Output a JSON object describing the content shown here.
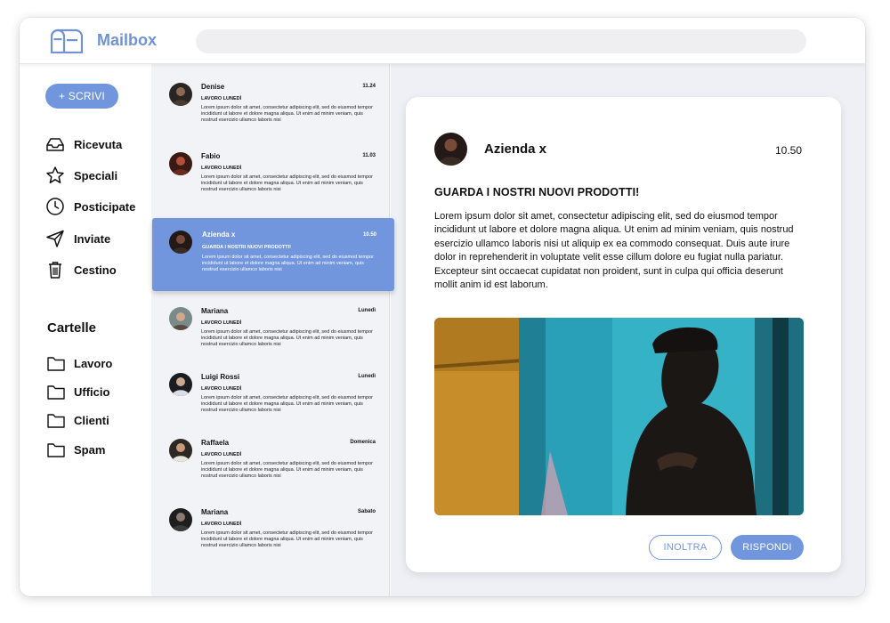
{
  "app": {
    "title": "Mailbox",
    "accent_color": "#7196de"
  },
  "search": {
    "value": "",
    "placeholder": ""
  },
  "sidebar": {
    "compose_label": "+ SCRIVI",
    "nav": [
      {
        "label": "Ricevuta",
        "icon": "inbox-icon"
      },
      {
        "label": "Speciali",
        "icon": "star-icon"
      },
      {
        "label": "Posticipate",
        "icon": "clock-icon"
      },
      {
        "label": "Inviate",
        "icon": "send-icon"
      },
      {
        "label": "Cestino",
        "icon": "trash-icon"
      }
    ],
    "folders_title": "Cartelle",
    "folders": [
      {
        "label": "Lavoro",
        "icon": "folder-icon"
      },
      {
        "label": "Ufficio",
        "icon": "folder-icon"
      },
      {
        "label": "Clienti",
        "icon": "folder-icon"
      },
      {
        "label": "Spam",
        "icon": "folder-icon"
      }
    ]
  },
  "messages": [
    {
      "name": "Denise",
      "time": "11.24",
      "subject": "LAVORO LUNEDÌ",
      "preview": "Lorem ipsum dolor sit amet, consectetur adipiscing elit, sed do eiusmod tempor incididunt ut labore et dolore magna aliqua. Ut enim ad minim veniam, quis nostrud esercizio ullamco laboris nisi"
    },
    {
      "name": "Fabio",
      "time": "11.03",
      "subject": "LAVORO LUNEDÌ",
      "preview": "Lorem ipsum dolor sit amet, consectetur adipiscing elit, sed do eiusmod tempor incididunt ut labore et dolore magna aliqua. Ut enim ad minim veniam, quis nostrud esercizio ullamco laboris nisi"
    },
    {
      "name": "Azienda x",
      "time": "10.50",
      "subject": "GUARDA I NOSTRI NUOVI PRODOTTI!",
      "preview": "Lorem ipsum dolor sit amet, consectetur adipiscing elit, sed do eiusmod tempor incididunt ut labore et dolore magna aliqua. Ut enim ad minim veniam, quis nostrud esercizio ullamco laboris nisi",
      "selected": true
    },
    {
      "name": "Mariana",
      "time": "Lunedì",
      "subject": "LAVORO LUNEDÌ",
      "preview": "Lorem ipsum dolor sit amet, consectetur adipiscing elit, sed do eiusmod tempor incididunt ut labore et dolore magna aliqua. Ut enim ad minim veniam, quis nostrud esercizio ullamco laboris nisi"
    },
    {
      "name": "Luigi Rossi",
      "time": "Lunedì",
      "subject": "LAVORO LUNEDÌ",
      "preview": "Lorem ipsum dolor sit amet, consectetur adipiscing elit, sed do eiusmod tempor incididunt ut labore et dolore magna aliqua. Ut enim ad minim veniam, quis nostrud esercizio ullamco laboris nisi"
    },
    {
      "name": "Raffaela",
      "time": "Domenica",
      "subject": "LAVORO LUNEDÌ",
      "preview": "Lorem ipsum dolor sit amet, consectetur adipiscing elit, sed do eiusmod tempor incididunt ut labore et dolore magna aliqua. Ut enim ad minim veniam, quis nostrud esercizio ullamco laboris nisi"
    },
    {
      "name": "Mariana",
      "time": "Sabato",
      "subject": "LAVORO LUNEDÌ",
      "preview": "Lorem ipsum dolor sit amet, consectetur adipiscing elit, sed do eiusmod tempor incididunt ut labore et dolore magna aliqua. Ut enim ad minim veniam, quis nostrud esercizio ullamco laboris nisi"
    }
  ],
  "reading": {
    "sender": "Azienda x",
    "time": "10.50",
    "subject": "GUARDA I NOSTRI NUOVI PRODOTTI!",
    "body": "Lorem ipsum dolor sit amet, consectetur adipiscing elit, sed do eiusmod tempor incididunt ut labore et dolore magna aliqua. Ut enim ad minim veniam, quis nostrud esercizio ullamco laboris nisi ut aliquip ex ea commodo consequat. Duis aute irure dolor in reprehenderit in voluptate velit esse cillum dolore eu fugiat nulla pariatur. Excepteur sint occaecat cupidatat non proident, sunt in culpa qui officia deserunt mollit anim id est laborum.",
    "forward_label": "INOLTRA",
    "reply_label": "RISPONDI"
  }
}
